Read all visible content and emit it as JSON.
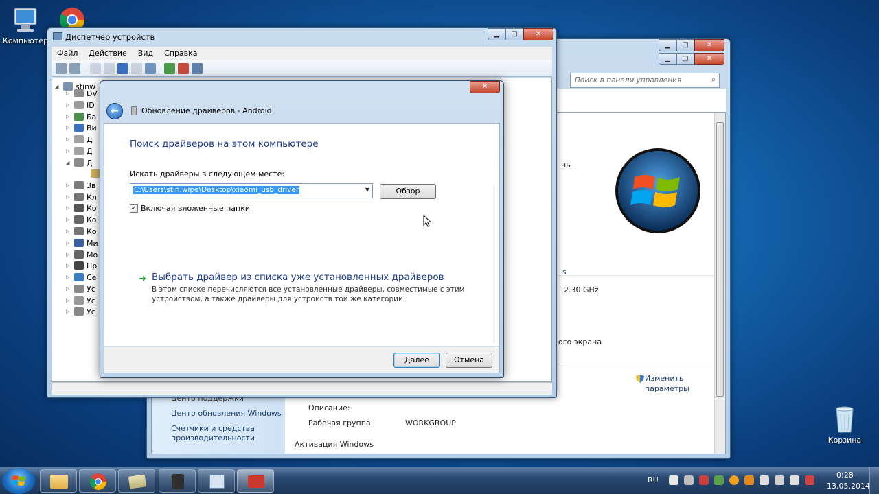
{
  "desktop": {
    "icons": [
      {
        "label": "Компьютер",
        "icon": "computer-icon"
      },
      {
        "label": "",
        "icon": "chrome-icon"
      },
      {
        "label": "Корзина",
        "icon": "recycle-bin-icon"
      }
    ]
  },
  "control_panel": {
    "search_placeholder": "Поиск в панели управления",
    "left_links": [
      "Центр поддержки",
      "Центр обновления Windows",
      "Счетчики и средства",
      "производительности"
    ],
    "partial_texts": [
      "ны.",
      "s",
      "2.30 GHz",
      "ого экрана"
    ],
    "change_params": [
      "Изменить",
      "параметры"
    ],
    "rows": [
      {
        "label": "Описание:",
        "value": ""
      },
      {
        "label": "Рабочая группа:",
        "value": "WORKGROUP"
      }
    ],
    "activation": "Активация Windows"
  },
  "device_manager": {
    "title": "Диспетчер устройств",
    "menu": [
      "Файл",
      "Действие",
      "Вид",
      "Справка"
    ],
    "root": "stinw",
    "nodes": [
      "DV",
      "ID",
      "Ба",
      "Ви",
      "Д",
      "Д",
      "Д",
      "",
      "Зв",
      "Кл",
      "Ко",
      "Ко",
      "Ко",
      "Ми",
      "Мо",
      "Пр",
      "Се",
      "Ус",
      "Ус",
      "Ус"
    ]
  },
  "dialog": {
    "title": "Обновление драйверов - Android",
    "heading": "Поиск драйверов на этом компьютере",
    "search_label": "Искать драйверы в следующем месте:",
    "path_value": "C:\\Users\\stin.wipe\\Desktop\\xiaomi_usb_driver",
    "browse_button": "Обзор",
    "include_subfolders": "Включая вложенные папки",
    "pick_link": "Выбрать драйвер из списка уже установленных драйверов",
    "pick_desc_1": "В этом списке перечисляются все установленные драйверы, совместимые с этим",
    "pick_desc_2": "устройством, а также драйверы для устройств той же категории.",
    "next_button": "Далее",
    "cancel_button": "Отмена"
  },
  "taskbar": {
    "language": "RU",
    "time": "0:28",
    "date": "13.05.2014"
  }
}
